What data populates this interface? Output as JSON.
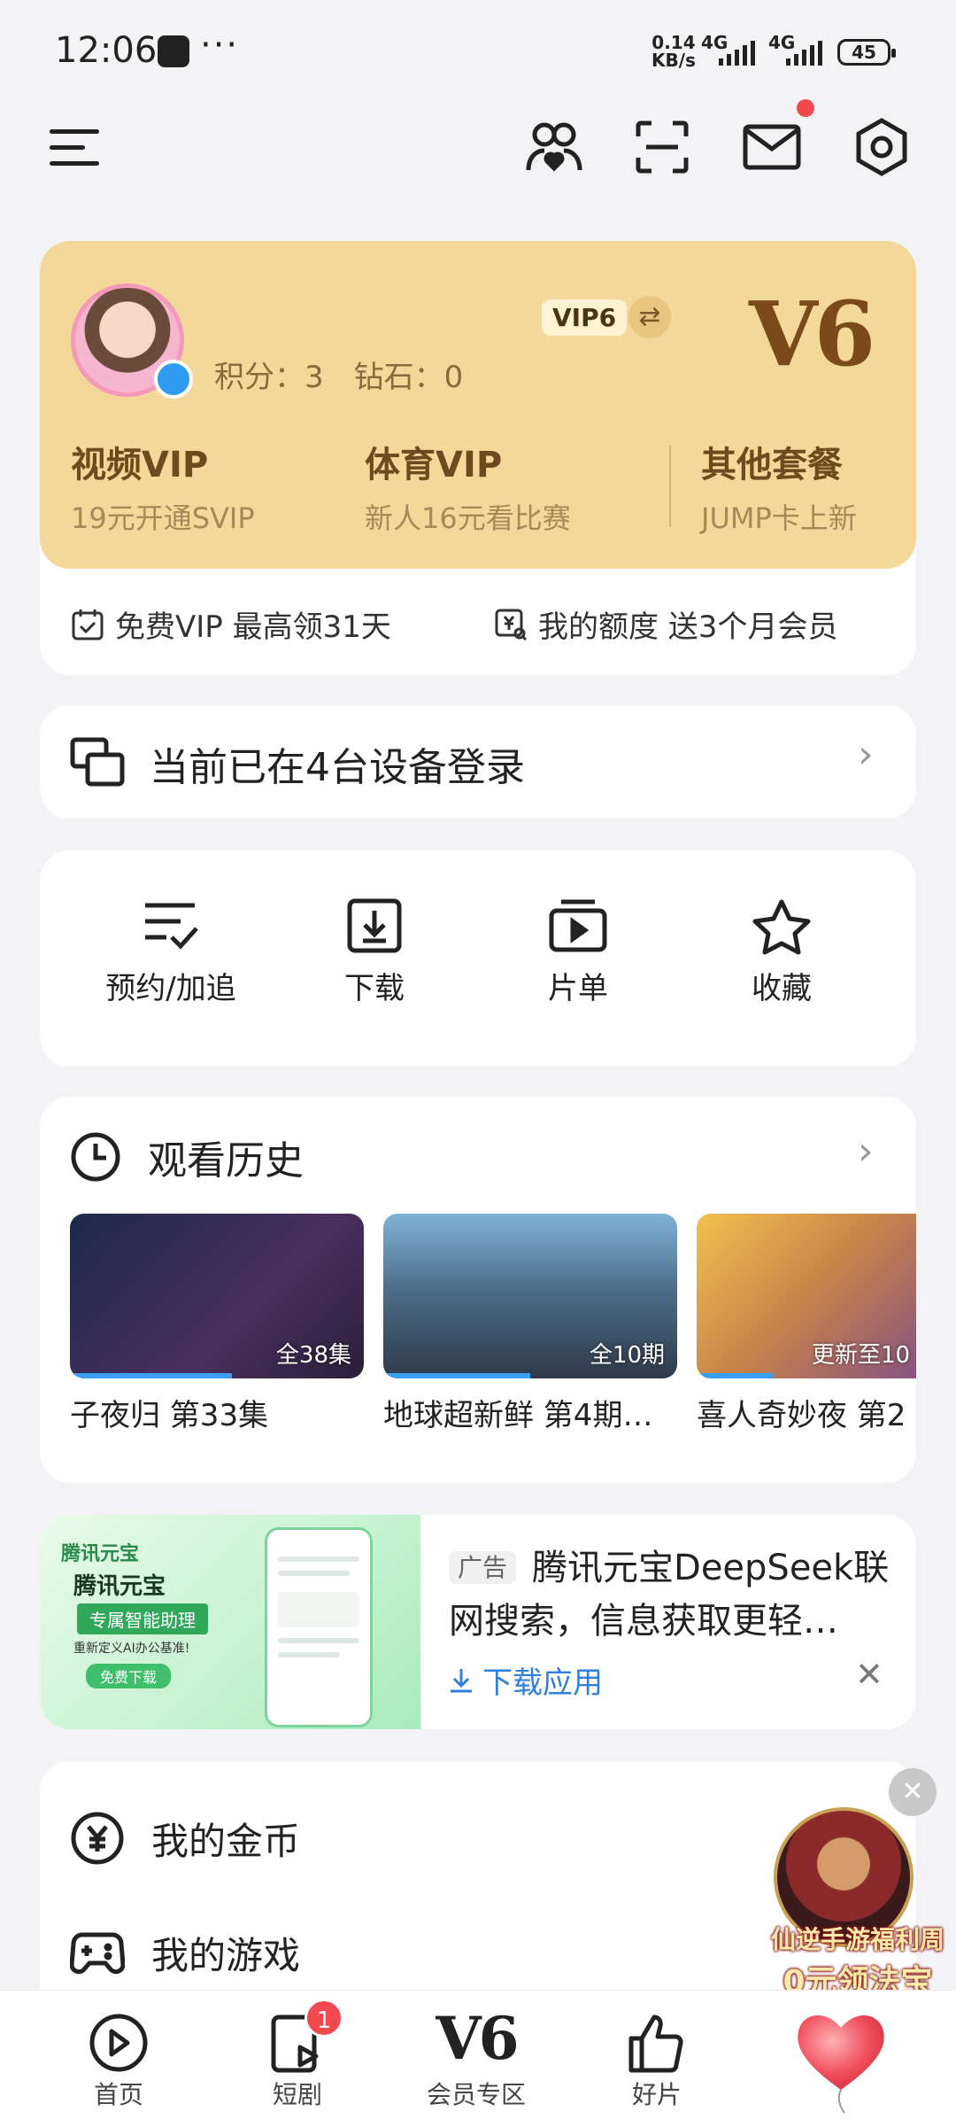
{
  "status_bar": {
    "time": "12:06",
    "dots": "···",
    "speed_top": "0.14",
    "speed_bottom": "KB/s",
    "net1": "4G",
    "net2": "4G",
    "battery": "45"
  },
  "toolbar": {
    "icons": [
      "menu-icon",
      "friends-icon",
      "scan-icon",
      "mail-icon",
      "settings-icon"
    ],
    "mail_has_unread": true
  },
  "vip": {
    "points": "积分：3　钻石：0",
    "vip_tag": "VIP6",
    "swap_icon": "⇄",
    "level": "V6",
    "columns": [
      {
        "title": "视频VIP",
        "subtitle": "19元开通SVIP"
      },
      {
        "title": "体育VIP",
        "subtitle": "新人16元看比赛"
      },
      {
        "title": "其他套餐",
        "subtitle": "JUMP卡上新"
      }
    ],
    "footer_left": "免费VIP 最高领31天",
    "footer_right": "我的额度 送3个月会员"
  },
  "devices": {
    "text": "当前已在4台设备登录",
    "chevron": "›"
  },
  "quick_actions": [
    {
      "label": "预约/加追",
      "icon": "list-check-icon"
    },
    {
      "label": "下载",
      "icon": "download-icon"
    },
    {
      "label": "片单",
      "icon": "playlist-icon"
    },
    {
      "label": "收藏",
      "icon": "star-icon"
    }
  ],
  "history": {
    "title": "观看历史",
    "chevron": "›",
    "items": [
      {
        "title": "子夜归 第33集",
        "tag": "全38集",
        "progress": 0.55,
        "colors": [
          "#1c2a4a",
          "#4a2f5e"
        ]
      },
      {
        "title": "地球超新鲜 第4期…",
        "tag": "全10期",
        "progress": 0.5,
        "colors": [
          "#7fb3d8",
          "#2e3a4a"
        ]
      },
      {
        "title": "喜人奇妙夜 第2",
        "tag": "更新至10",
        "progress": 0.3,
        "colors": [
          "#f2c14e",
          "#7a4a8a"
        ]
      }
    ]
  },
  "ad": {
    "tag": "广告",
    "text": "腾讯元宝DeepSeek联网搜索，信息获取更轻…",
    "download": "下载应用",
    "close": "✕",
    "image_brand": "腾讯元宝",
    "image_title": "腾讯元宝",
    "image_subtitle": "专属智能助理",
    "image_note": "重新定义AI办公基准!",
    "image_button": "免费下载"
  },
  "menu": [
    {
      "label": "我的金币",
      "icon": "coin-icon"
    },
    {
      "label": "我的游戏",
      "icon": "gamepad-icon"
    }
  ],
  "floating_ad": {
    "line1": "仙逆手游福利周",
    "line2": "0元领法宝",
    "close": "✕"
  },
  "nav": [
    {
      "label": "首页",
      "icon": "home-play-icon"
    },
    {
      "label": "短剧",
      "icon": "short-drama-icon",
      "badge": "1"
    },
    {
      "label": "会员专区",
      "icon": "v6-icon",
      "glyph": "V6"
    },
    {
      "label": "好片",
      "icon": "thumbs-up-icon"
    },
    {
      "label": "",
      "icon": "heart-balloon-icon"
    }
  ]
}
